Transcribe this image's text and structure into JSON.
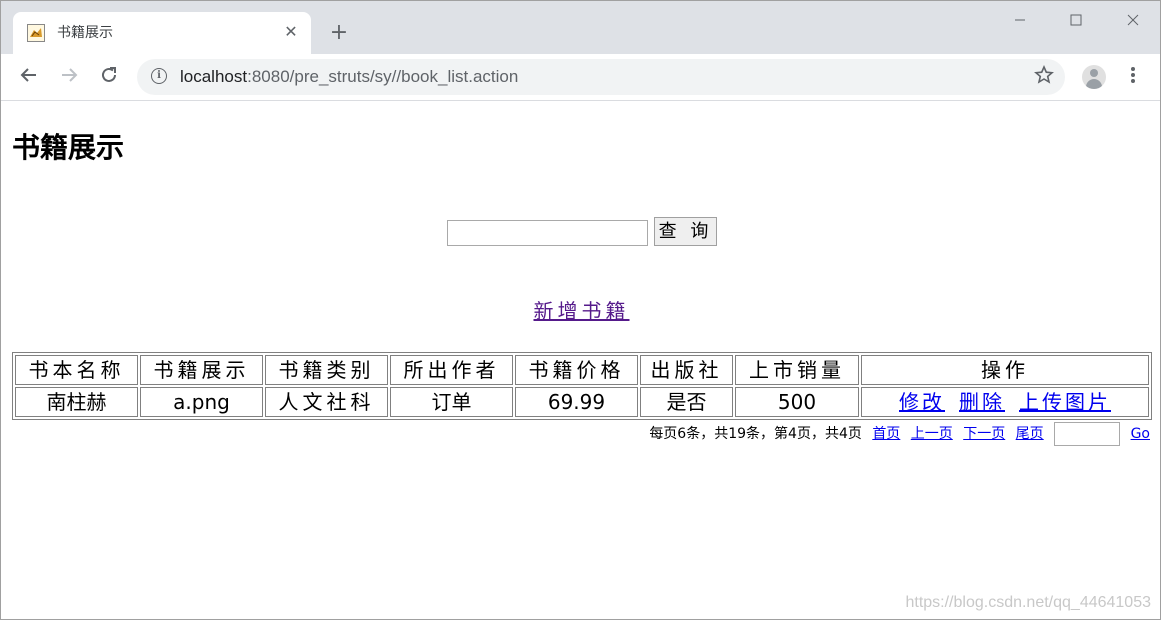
{
  "browser": {
    "tab_title": "书籍展示",
    "tab_close": "✕",
    "new_tab": "+",
    "url_host": "localhost",
    "url_rest": ":8080/pre_struts/sy//book_list.action"
  },
  "page": {
    "title": "书籍展示",
    "search_button": "查 询",
    "search_value": "",
    "add_link": "新增书籍 "
  },
  "table": {
    "headers": [
      "书本名称",
      "书籍展示",
      "书籍类别",
      "所出作者",
      "书籍价格",
      "出版社",
      "上市销量",
      "操作"
    ],
    "rows": [
      {
        "name": "南柱赫",
        "image": "a.png",
        "category": "人文社科",
        "author": "订单",
        "price": "69.99",
        "publisher": "是否",
        "sales": "500",
        "actions": [
          "修改",
          "删除",
          "上传图片"
        ]
      }
    ]
  },
  "pager": {
    "summary": "每页6条，共19条，第4页，共4页",
    "first": "首页",
    "prev": "上一页",
    "next": "下一页",
    "last": "尾页",
    "go": "Go"
  },
  "watermark": "https://blog.csdn.net/qq_44641053",
  "icons": {
    "back": "arrow-left",
    "forward": "arrow-right",
    "reload": "reload",
    "info": "info",
    "star": "star",
    "menu": "vertical-ellipsis"
  }
}
